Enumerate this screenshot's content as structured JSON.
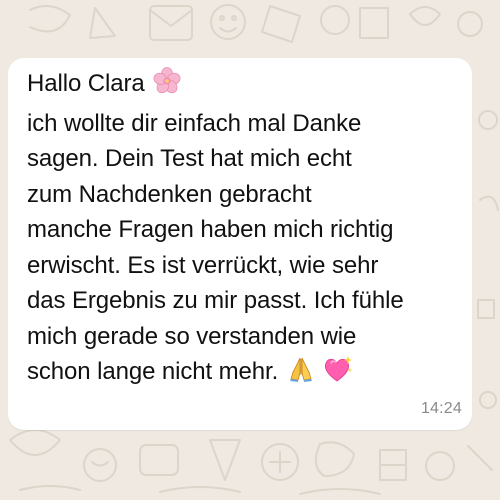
{
  "message": {
    "lines": [
      "Hallo Clara",
      "ich wollte dir einfach mal Danke",
      "sagen. Dein Test hat mich echt",
      "zum Nachdenken gebracht",
      "manche Fragen haben mich richtig",
      "erwischt. Es ist verrückt, wie sehr",
      "das Ergebnis zu mir passt. Ich fühle",
      "mich gerade so verstanden wie",
      "schon lange nicht mehr."
    ],
    "emojis": [
      "cherry-blossom-icon",
      "folded-hands-icon",
      "sparkling-heart-icon"
    ],
    "time": "14:24"
  },
  "colors": {
    "background": "#efe9e1",
    "bubble": "#ffffff",
    "text": "#111111",
    "timestamp": "#8a8a8a"
  }
}
